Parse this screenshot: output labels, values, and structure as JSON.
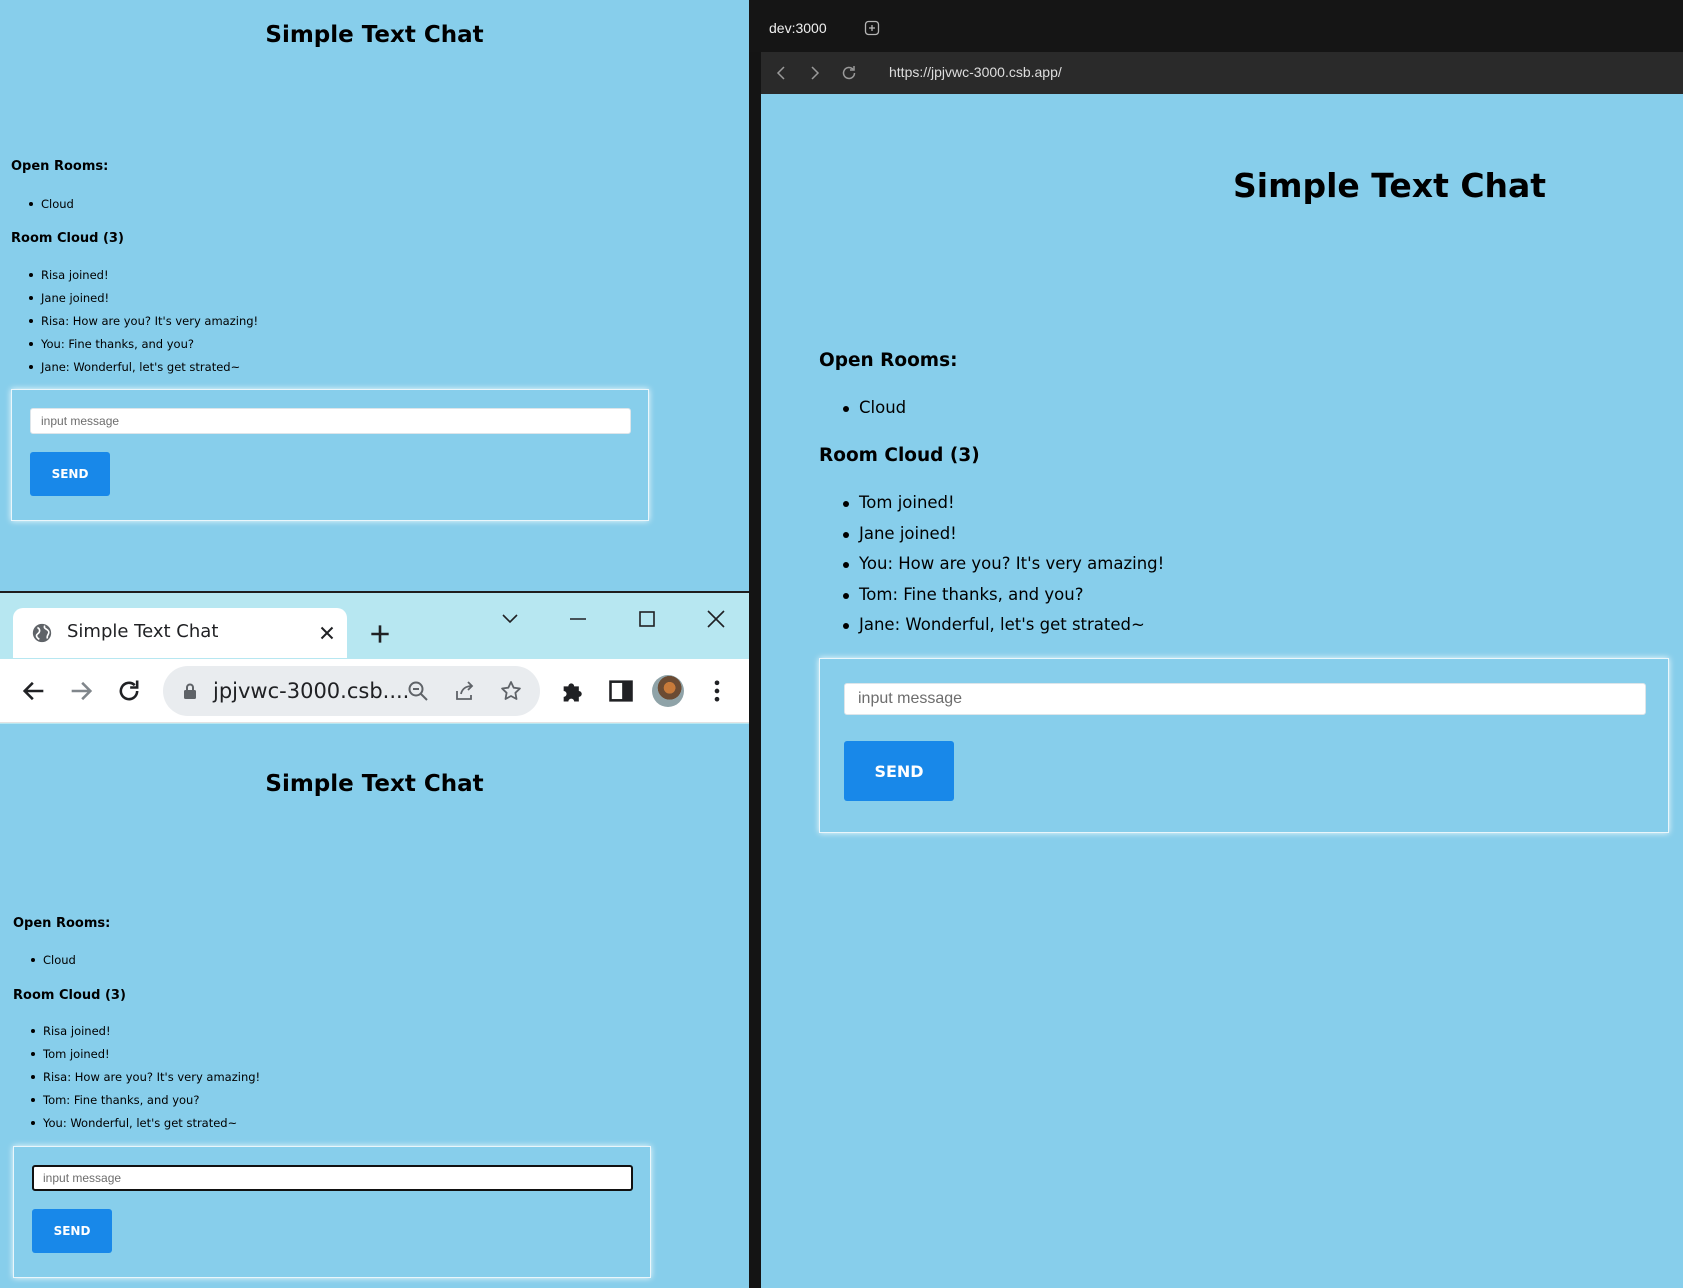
{
  "colors": {
    "page_bg": "#87ceeb",
    "send_button": "#1888e9",
    "chrome_tabstrip": "#b7e7f1",
    "dark_shell": "#141414"
  },
  "window_top_left": {
    "title": "Simple Text Chat",
    "open_rooms_label": "Open Rooms:",
    "rooms": [
      "Cloud"
    ],
    "room_label": "Room Cloud (3)",
    "messages": [
      "Risa joined!",
      "Jane joined!",
      "Risa: How are you? It's very amazing!",
      "You: Fine thanks, and you?",
      "Jane: Wonderful, let's get strated~"
    ],
    "input_placeholder": "input message",
    "send_label": "SEND"
  },
  "window_chrome": {
    "tab_title": "Simple Text Chat",
    "url": "jpjvwc-3000.csb....",
    "icons": {
      "favicon": "globe-icon",
      "tab_close": "close-icon",
      "new_tab": "plus-icon",
      "tab_search": "chevron-down-icon",
      "minimize": "minimize-icon",
      "maximize": "maximize-icon",
      "close_window": "close-icon",
      "back": "arrow-left-icon",
      "forward": "arrow-right-icon",
      "reload": "reload-icon",
      "lock": "lock-icon",
      "zoom": "zoom-out-icon",
      "share": "share-icon",
      "bookmark": "star-icon",
      "extensions": "puzzle-icon",
      "side_panel": "side-panel-icon",
      "menu": "kebab-menu-icon"
    },
    "title": "Simple Text Chat",
    "open_rooms_label": "Open Rooms:",
    "rooms": [
      "Cloud"
    ],
    "room_label": "Room Cloud (3)",
    "messages": [
      "Risa joined!",
      "Tom joined!",
      "Risa: How are you? It's very amazing!",
      "Tom: Fine thanks, and you?",
      "You: Wonderful, let's get strated~"
    ],
    "input_placeholder": "input message",
    "send_label": "SEND"
  },
  "window_right": {
    "tab_label": "dev:3000",
    "url": "https://jpjvwc-3000.csb.app/",
    "icons": {
      "add_tab": "plus-square-icon",
      "back": "chevron-left-icon",
      "forward": "chevron-right-icon",
      "reload": "reload-icon"
    },
    "title": "Simple Text Chat",
    "open_rooms_label": "Open Rooms:",
    "rooms": [
      "Cloud"
    ],
    "room_label": "Room Cloud (3)",
    "messages": [
      "Tom joined!",
      "Jane joined!",
      "You: How are you? It's very amazing!",
      "Tom: Fine thanks, and you?",
      "Jane: Wonderful, let's get strated~"
    ],
    "input_placeholder": "input message",
    "send_label": "SEND"
  }
}
